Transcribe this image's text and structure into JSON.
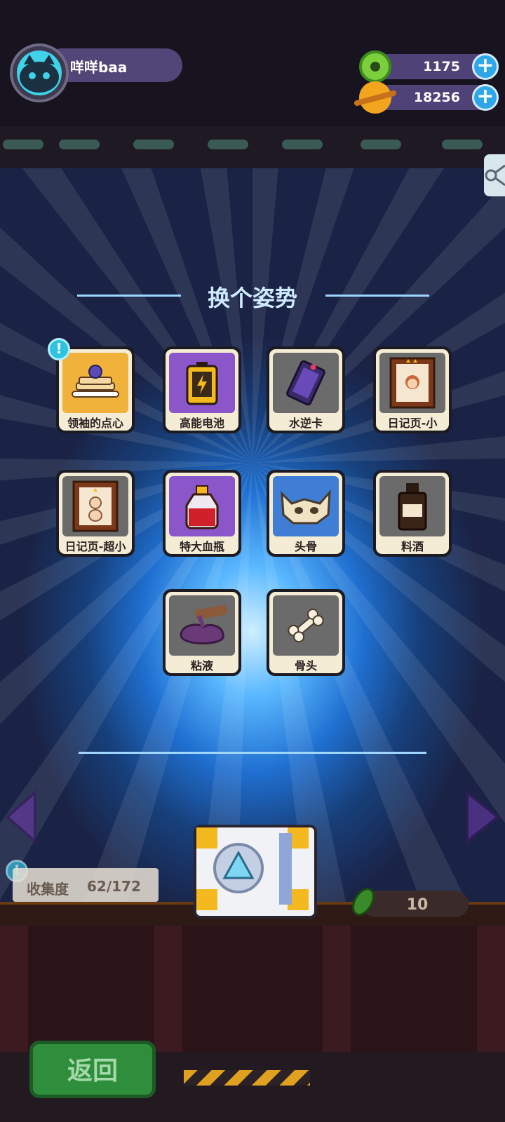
{
  "header": {
    "player_name": "咩咩baa",
    "currency_1": {
      "value": "1175",
      "icon": "green-donut-icon"
    },
    "currency_2": {
      "value": "18256",
      "icon": "orange-planet-icon"
    },
    "plus_symbol": "+"
  },
  "dialog": {
    "title": "换个姿势",
    "items": [
      {
        "label": "领袖的点心",
        "icon": "cake-icon",
        "bg": "#f0b23a",
        "badge": "!"
      },
      {
        "label": "高能电池",
        "icon": "battery-icon",
        "bg": "#8a56c9"
      },
      {
        "label": "水逆卡",
        "icon": "card-icon",
        "bg": "#6b6b6b"
      },
      {
        "label": "日记页-小",
        "icon": "diary-page-icon",
        "bg": "#6b6b6b"
      },
      {
        "label": "日记页-超小",
        "icon": "diary-page-icon",
        "bg": "#6b6b6b"
      },
      {
        "label": "特大血瓶",
        "icon": "potion-icon",
        "bg": "#8a56c9"
      },
      {
        "label": "头骨",
        "icon": "skull-icon",
        "bg": "#3f7ed4"
      },
      {
        "label": "料酒",
        "icon": "bottle-icon",
        "bg": "#6b6b6b"
      },
      {
        "label": "粘液",
        "icon": "slime-icon",
        "bg": "#6b6b6b"
      },
      {
        "label": "骨头",
        "icon": "bone-icon",
        "bg": "#6b6b6b"
      }
    ]
  },
  "bottom": {
    "collection_label": "收集度",
    "collection_value": "62/172",
    "cost_value": "10",
    "back_label": "返回",
    "badge": "!"
  },
  "colors": {
    "accent": "#2fa6e8",
    "title": "#cfeaff",
    "back_button": "#2f8e3c"
  }
}
